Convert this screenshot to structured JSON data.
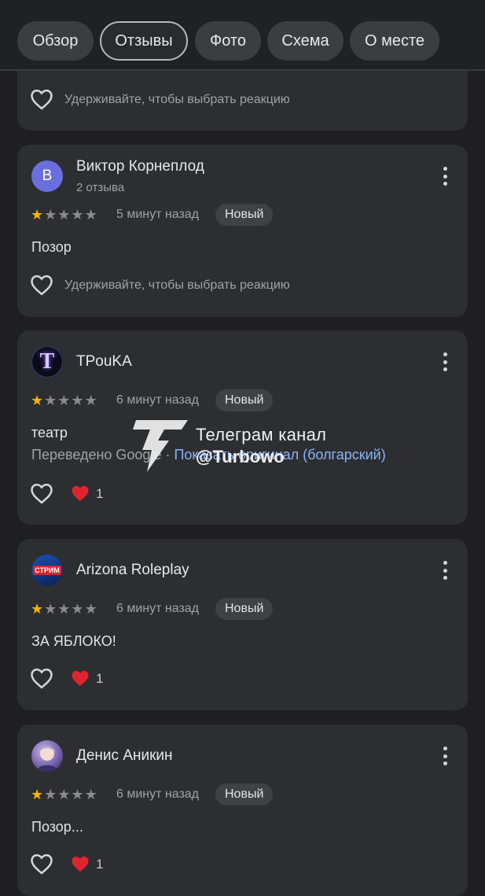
{
  "tabs": [
    {
      "label": "Обзор",
      "active": false
    },
    {
      "label": "Отзывы",
      "active": true
    },
    {
      "label": "Фото",
      "active": false
    },
    {
      "label": "Схема",
      "active": false
    },
    {
      "label": "О месте",
      "active": false
    }
  ],
  "reaction_hint": "Удерживайте, чтобы выбрать реакцию",
  "reviews": [
    {
      "author": "Виктор Корнеплод",
      "avatar_letter": "В",
      "reviews_count": "2 отзыва",
      "rating": 1,
      "time": "5 минут назад",
      "badge": "Новый",
      "text": "Позор"
    },
    {
      "author": "TPouKA",
      "avatar_letter": "T",
      "rating": 1,
      "time": "6 минут назад",
      "badge": "Новый",
      "text": "театр",
      "translated_prefix": "Переведено Google · ",
      "translated_link": "Показать оригинал (болгарский)",
      "reaction_count": "1"
    },
    {
      "author": "Arizona Roleplay",
      "avatar_text": "СТРИМ",
      "rating": 1,
      "time": "6 минут назад",
      "badge": "Новый",
      "text": "ЗА ЯБЛОКО!",
      "reaction_count": "1"
    },
    {
      "author": "Денис Аникин",
      "rating": 1,
      "time": "6 минут назад",
      "badge": "Новый",
      "text": "Позор...",
      "reaction_count": "1"
    }
  ],
  "watermark": {
    "line1": "Телеграм канал",
    "line2": "@Turbowo"
  },
  "colors": {
    "background": "#1f1f21",
    "card": "#2d2e31",
    "star": "#f4b400",
    "link": "#8ab4f8",
    "reaction": "#e0242f"
  }
}
